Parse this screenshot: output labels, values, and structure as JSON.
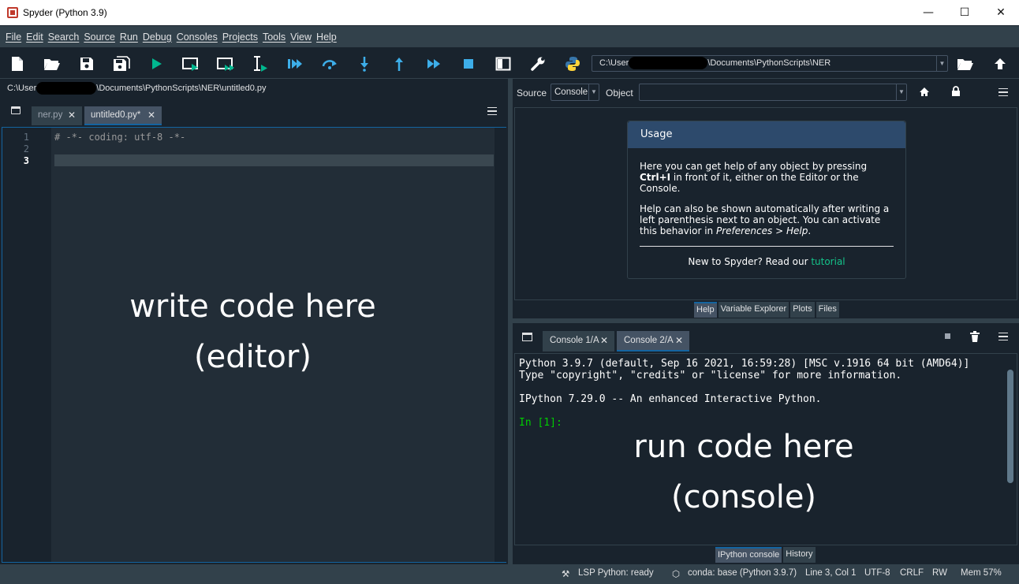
{
  "window": {
    "title": "Spyder (Python 3.9)",
    "minimize_glyph": "—",
    "maximize_glyph": "☐",
    "close_glyph": "✕"
  },
  "menu": [
    "File",
    "Edit",
    "Search",
    "Source",
    "Run",
    "Debug",
    "Consoles",
    "Projects",
    "Tools",
    "View",
    "Help"
  ],
  "toolbar": {
    "icons": [
      "new-file-icon",
      "open-file-icon",
      "save-icon",
      "save-all-icon",
      "run-icon",
      "run-cell-icon",
      "run-cell-advance-icon",
      "run-selection-icon",
      "debug-icon",
      "step-over-icon",
      "step-into-icon",
      "step-return-icon",
      "continue-icon",
      "stop-debug-icon",
      "maximize-pane-icon",
      "preferences-icon",
      "python-path-icon",
      "browse-directory-icon",
      "parent-directory-icon"
    ],
    "working_dir_prefix": "C:\\User",
    "working_dir_suffix": "\\Documents\\PythonScripts\\NER"
  },
  "editor": {
    "path_prefix": "C:\\User",
    "path_suffix": "\\Documents\\PythonScripts\\NER\\untitled0.py",
    "tabs": [
      {
        "label": "ner.py",
        "active": false
      },
      {
        "label": "untitled0.py*",
        "active": true
      }
    ],
    "close_glyph": "✕",
    "line_numbers": [
      "1",
      "2",
      "3"
    ],
    "current_line": "3",
    "lines": [
      "# -*- coding: utf-8 -*-",
      "",
      ""
    ],
    "overlay_line1": "write code here",
    "overlay_line2": "(editor)"
  },
  "help": {
    "source_label": "Source",
    "source_value": "Console",
    "object_label": "Object",
    "object_value": "",
    "usage_title": "Usage",
    "para1_a": "Here you can get help of any object by pressing",
    "para1_bold": "Ctrl+I",
    "para1_b": " in front of it, either on the Editor or the",
    "para1_c": "Console.",
    "para2_a": "Help can also be shown automatically after writing a",
    "para2_b": "left parenthesis next to an object. You can activate",
    "para2_c": "this behavior in ",
    "para2_italic": "Preferences > Help",
    "para2_end": ".",
    "new_to": "New to Spyder? Read our ",
    "tutorial_link": "tutorial",
    "bottom_tabs": [
      "Help",
      "Variable Explorer",
      "Plots",
      "Files"
    ],
    "active_bottom_tab": "Help"
  },
  "console": {
    "tabs": [
      {
        "label": "Console 1/A",
        "active": false
      },
      {
        "label": "Console 2/A",
        "active": true
      }
    ],
    "close_glyph": "✕",
    "lines": [
      "Python 3.9.7 (default, Sep 16 2021, 16:59:28) [MSC v.1916 64 bit (AMD64)]",
      "Type \"copyright\", \"credits\" or \"license\" for more information.",
      "IPython 7.29.0 -- An enhanced Interactive Python."
    ],
    "prompt": "In [1]:",
    "overlay_line1": "run code here",
    "overlay_line2": "(console)",
    "bottom_tabs": [
      "IPython console",
      "History"
    ],
    "active_bottom_tab": "IPython console"
  },
  "status": {
    "lsp": "LSP Python: ready",
    "conda": "conda: base (Python 3.9.7)",
    "position": "Line 3, Col 1",
    "encoding": "UTF-8",
    "eol": "CRLF",
    "rw": "RW",
    "mem": "Mem 57%"
  },
  "colors": {
    "background": "#19232d",
    "panel": "#32414b",
    "accent": "#1464a0",
    "link": "#14c48a",
    "prompt": "#00cc00",
    "run": "#00b78f"
  }
}
